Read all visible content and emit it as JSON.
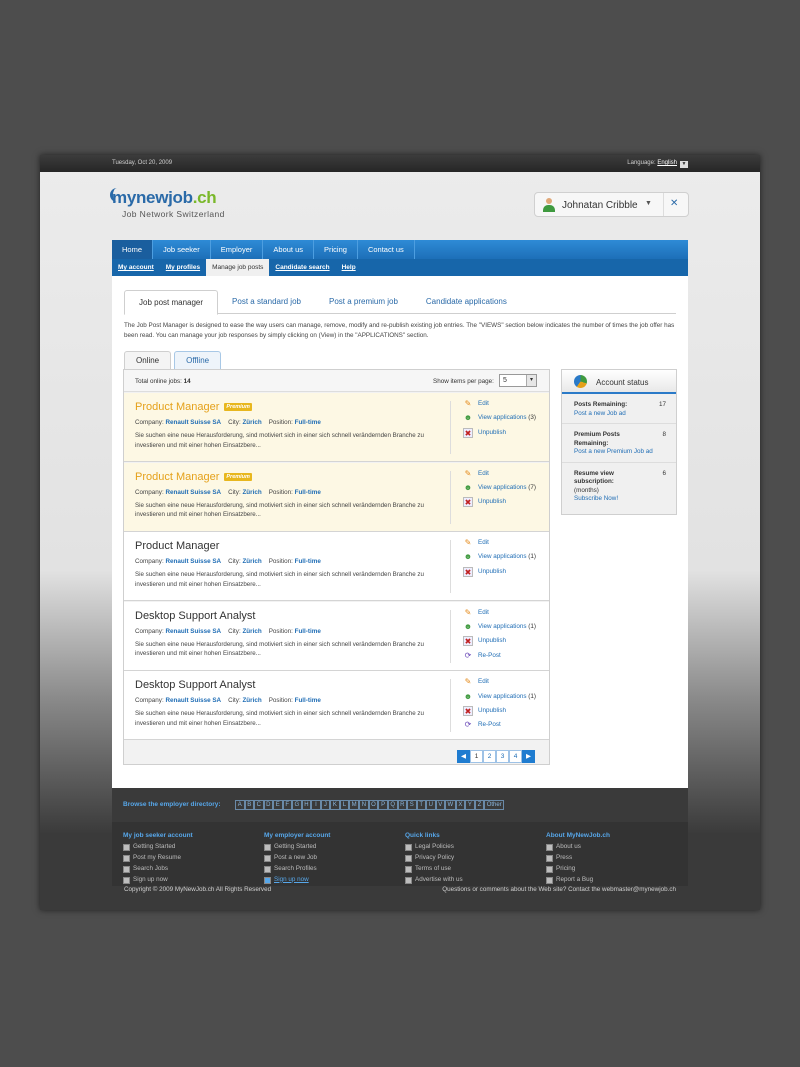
{
  "topbar": {
    "date": "Tuesday, Oct 20, 2009",
    "language_label": "Language:",
    "language_value": "English"
  },
  "logo": {
    "brand_main": "mynewjob",
    "brand_tld": ".ch",
    "tagline": "Job Network Switzerland"
  },
  "user": {
    "name": "Johnatan Cribble"
  },
  "nav": [
    "Home",
    "Job seeker",
    "Employer",
    "About us",
    "Pricing",
    "Contact us"
  ],
  "subnav": [
    "My account",
    "My profiles",
    "Manage job posts",
    "Candidate search",
    "Help"
  ],
  "tabs": [
    "Job post manager",
    "Post a standard job",
    "Post a premium job",
    "Candidate applications"
  ],
  "intro": "The Job Post Manager is designed to ease the way users can manage, remove, modify and re-publish existing job entries. The \"VIEWS\" section below indicates the number of times the job offer has been read.  You can manage your job responses by simply clicking on (View) in the \"APPLICATIONS\" section.",
  "subtabs": [
    "Online",
    "Offline"
  ],
  "list": {
    "total_label": "Total online jobs:",
    "total": "14",
    "show_label": "Show items per page:",
    "per_page": "5"
  },
  "labels": {
    "company": "Company:",
    "city": "City:",
    "position": "Position:",
    "edit": "Edit",
    "view": "View applications",
    "unpublish": "Unpublish",
    "repost": "Re-Post",
    "premium": "Premium"
  },
  "jobs": [
    {
      "title": "Product Manager",
      "premium": true,
      "company": "Renault Suisse SA",
      "city": "Zürich",
      "position": "Full-time",
      "desc": "Sie suchen eine neue Herausforderung, sind motiviert sich in einer sich schnell verändernden Branche zu investieren und mit einer hohen Einsatzbere...",
      "applications": "(3)"
    },
    {
      "title": "Product Manager",
      "premium": true,
      "company": "Renault Suisse SA",
      "city": "Zürich",
      "position": "Full-time",
      "desc": "Sie suchen eine neue Herausforderung, sind motiviert sich in einer sich schnell verändernden Branche zu investieren und mit einer hohen Einsatzbere...",
      "applications": "(7)"
    },
    {
      "title": "Product Manager",
      "premium": false,
      "company": "Renault Suisse SA",
      "city": "Zürich",
      "position": "Full-time",
      "desc": "Sie suchen eine neue Herausforderung, sind motiviert sich in einer sich schnell verändernden Branche zu investieren und mit einer hohen Einsatzbere...",
      "applications": "(1)"
    },
    {
      "title": "Desktop Support Analyst",
      "premium": false,
      "company": "Renault Suisse SA",
      "city": "Zürich",
      "position": "Full-time",
      "desc": "Sie suchen eine neue Herausforderung, sind motiviert sich in einer sich schnell verändernden Branche zu investieren und mit einer hohen Einsatzbere...",
      "applications": "(1)",
      "repost": true
    },
    {
      "title": "Desktop Support Analyst",
      "premium": false,
      "company": "Renault Suisse SA",
      "city": "Zürich",
      "position": "Full-time",
      "desc": "Sie suchen eine neue Herausforderung, sind motiviert sich in einer sich schnell verändernden Branche zu investieren und mit einer hohen Einsatzbere...",
      "applications": "(1)",
      "repost": true
    }
  ],
  "pager": [
    "1",
    "2",
    "3",
    "4"
  ],
  "account": {
    "title": "Account status",
    "rows": [
      {
        "label": "Posts Remaining:",
        "value": "17",
        "link": "Post a new Job ad"
      },
      {
        "label": "Premium Posts Remaining:",
        "value": "8",
        "link": "Post a new Premium Job ad"
      },
      {
        "label": "Resume view subscription:",
        "sub": "(months)",
        "value": "6",
        "link": "Subscribe Now!"
      }
    ]
  },
  "directory": {
    "label": "Browse the employer directory:",
    "letters": [
      "A",
      "B",
      "C",
      "D",
      "E",
      "F",
      "G",
      "H",
      "I",
      "J",
      "K",
      "L",
      "M",
      "N",
      "O",
      "P",
      "Q",
      "R",
      "S",
      "T",
      "U",
      "V",
      "W",
      "X",
      "Y",
      "Z",
      "Other"
    ]
  },
  "footer": {
    "columns": [
      {
        "heading": "My job seeker account",
        "items": [
          "Getting Started",
          "Post my Resume",
          "Search Jobs",
          "Sign up now"
        ]
      },
      {
        "heading": "My employer account",
        "items": [
          "Getting Started",
          "Post a new Job",
          "Search Profiles",
          "Sign up now"
        ]
      },
      {
        "heading": "Quick links",
        "items": [
          "Legal Policies",
          "Privacy Policy",
          "Terms of use",
          "Advertise with us"
        ]
      },
      {
        "heading": "About MyNewJob.ch",
        "items": [
          "About us",
          "Press",
          "Pricing",
          "Report a Bug"
        ]
      }
    ],
    "copyright": "Copyright © 2009 MyNewJob.ch All Rights Reserved",
    "contact": "Questions or comments about the Web site? Contact the webmaster@mynewjob.ch"
  },
  "colors": {
    "brand_blue": "#2a6aa8",
    "brand_green": "#7ab82a",
    "premium_orange": "#e5a11a",
    "nav_blue": "#1d6fb8"
  }
}
